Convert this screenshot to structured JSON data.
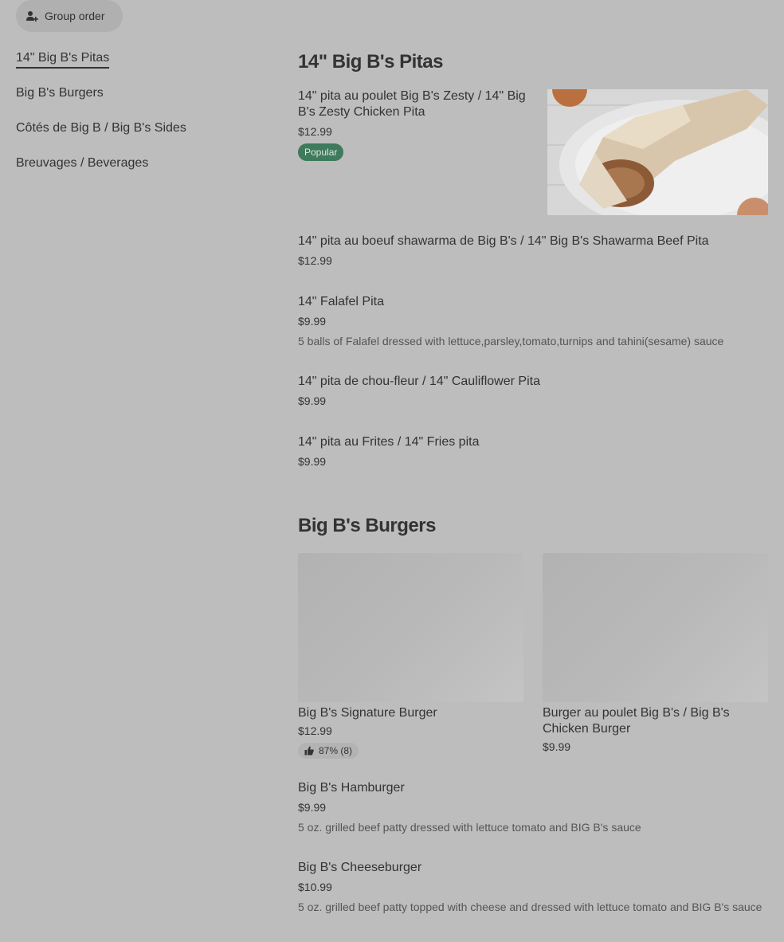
{
  "group_order": {
    "label": "Group order",
    "icon": "add-person-icon"
  },
  "sidebar": {
    "items": [
      {
        "label": "14\" Big B's Pitas"
      },
      {
        "label": "Big B's Burgers"
      },
      {
        "label": "Côtés de Big B / Big B's Sides"
      },
      {
        "label": "Breuvages / Beverages"
      }
    ]
  },
  "sections": {
    "pitas": {
      "title": "14\" Big B's Pitas",
      "items": [
        {
          "name": "14\" pita au poulet Big B's Zesty / 14\" Big B's Zesty Chicken Pita",
          "price": "$12.99",
          "badge": "Popular"
        },
        {
          "name": "14\" pita au boeuf shawarma de Big B's / 14\" Big B's Shawarma Beef Pita",
          "price": "$12.99"
        },
        {
          "name": "14\" Falafel Pita",
          "price": "$9.99",
          "description": "5 balls of Falafel dressed with lettuce,parsley,tomato,turnips and tahini(sesame) sauce"
        },
        {
          "name": "14\" pita de chou-fleur / 14\" Cauliflower Pita",
          "price": "$9.99"
        },
        {
          "name": "14\" pita au Frites / 14\" Fries pita",
          "price": "$9.99"
        }
      ]
    },
    "burgers": {
      "title": "Big B's Burgers",
      "cards": [
        {
          "name": "Big B's Signature Burger",
          "price": "$12.99",
          "rating": "87% (8)"
        },
        {
          "name": "Burger au poulet Big B's / Big B's Chicken Burger",
          "price": "$9.99"
        }
      ],
      "items": [
        {
          "name": "Big B's Hamburger",
          "price": "$9.99",
          "description": "5 oz. grilled beef patty dressed with lettuce tomato and BIG B's sauce"
        },
        {
          "name": "Big B's Cheeseburger",
          "price": "$10.99",
          "description": "5 oz. grilled beef patty topped with cheese and dressed with lettuce tomato and BIG B's sauce"
        }
      ]
    }
  },
  "colors": {
    "background": "#bdbdbd",
    "popular_badge": "#3e7a5b",
    "text": "#333333"
  }
}
